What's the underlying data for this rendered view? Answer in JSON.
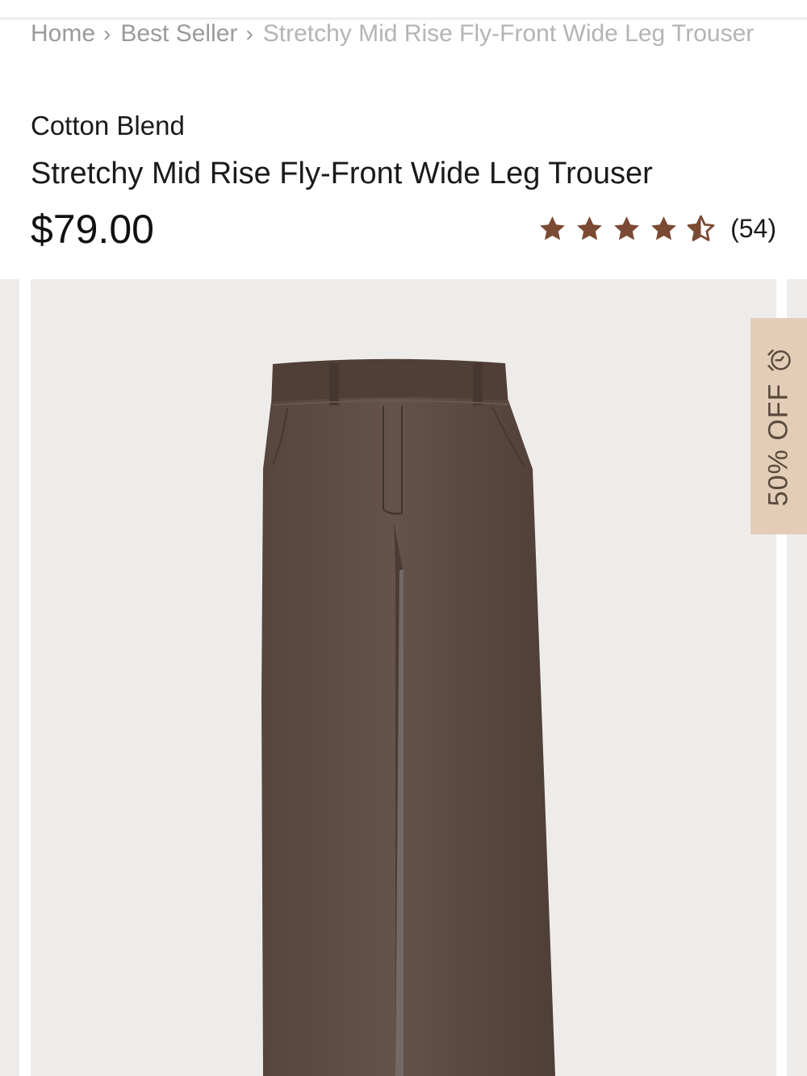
{
  "breadcrumb": {
    "items": [
      "Home",
      "Best Seller"
    ],
    "current": "Stretchy Mid Rise Fly-Front Wide Leg Trouser",
    "separator_icon": "chevron-right-icon"
  },
  "product": {
    "collection": "Cotton Blend",
    "title": "Stretchy Mid Rise Fly-Front Wide Leg Trouser",
    "price": "$79.00",
    "rating": 4.5,
    "rating_max": 5,
    "review_count": "(54)",
    "star_color": "#7a4a33"
  },
  "gallery": {
    "product_color": "#5f4c42",
    "background_color": "#eeecea"
  },
  "sale_tag": {
    "label": "50% OFF",
    "icon": "alarm-clock-icon",
    "background_color": "#e3cdb7",
    "text_color": "#5b4a3e"
  }
}
